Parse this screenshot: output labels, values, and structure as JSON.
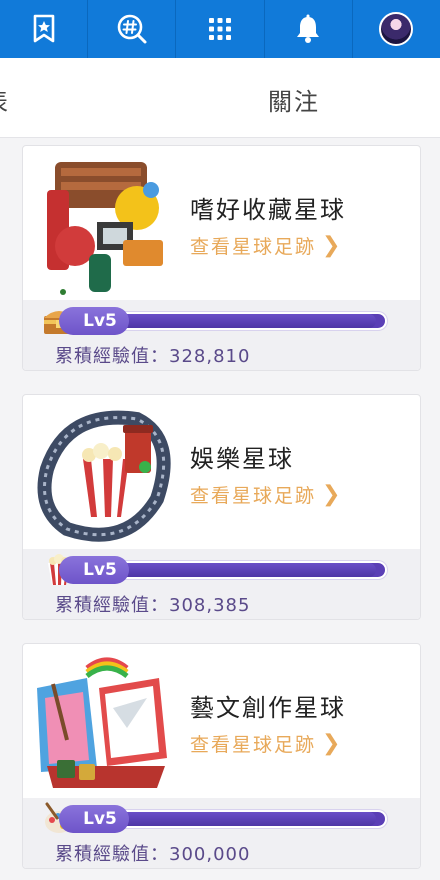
{
  "topbar": {
    "icons": [
      "bookmark-star-icon",
      "hashtag-search-icon",
      "grid-menu-icon",
      "bell-icon",
      "avatar"
    ]
  },
  "tabs": [
    {
      "label": "表"
    },
    {
      "label": "關注"
    }
  ],
  "cards": [
    {
      "title": "嗜好收藏星球",
      "link": "查看星球足跡",
      "level": "Lv5",
      "progress": 0.97,
      "exp_label": "累積經驗值：328,810",
      "icon": "treasure-chest-icon"
    },
    {
      "title": "娛樂星球",
      "link": "查看星球足跡",
      "level": "Lv5",
      "progress": 0.97,
      "exp_label": "累積經驗值：308,385",
      "icon": "popcorn-icon"
    },
    {
      "title": "藝文創作星球",
      "link": "查看星球足跡",
      "level": "Lv5",
      "progress": 0.97,
      "exp_label": "累積經驗值：300,000",
      "icon": "paint-palette-icon"
    }
  ],
  "colors": {
    "topbar": "#117ad9",
    "link": "#e8a95a",
    "bar": "#5b3fb6"
  }
}
